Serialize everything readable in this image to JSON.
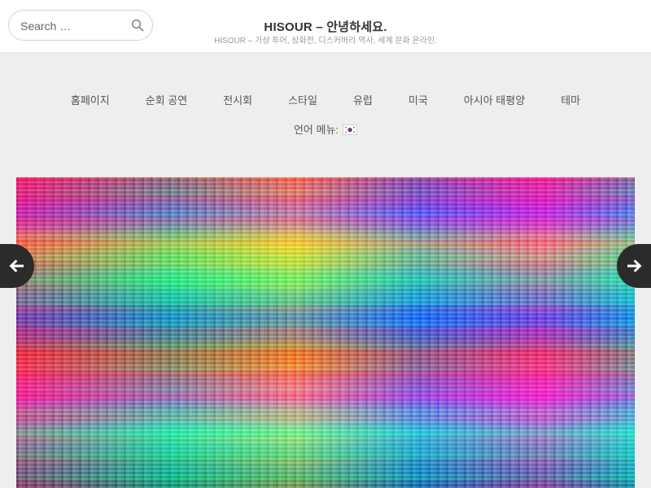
{
  "search": {
    "placeholder": "Search …"
  },
  "site": {
    "title": "HISOUR – 안녕하세요.",
    "tagline": "HISOUR – 가상 투어, 상화전, 디스커버리 역사, 세계 문화 온라인."
  },
  "nav": {
    "items": [
      {
        "label": "홈페이지"
      },
      {
        "label": "순회 공연"
      },
      {
        "label": "전시회"
      },
      {
        "label": "스타일"
      },
      {
        "label": "유럽"
      },
      {
        "label": "미국"
      },
      {
        "label": "아시아 태평양"
      },
      {
        "label": "테마"
      }
    ],
    "language_label": "언어 메뉴:",
    "language_flag": "south-korea-flag-icon"
  },
  "slider": {
    "prev_icon": "arrow-left-icon",
    "next_icon": "arrow-right-icon"
  },
  "colors": {
    "header_bg": "#ffffff",
    "band_bg": "#eeeeee",
    "arrow_bg": "#2b2b2b",
    "title": "#333333",
    "tagline": "#9a9a9a"
  }
}
